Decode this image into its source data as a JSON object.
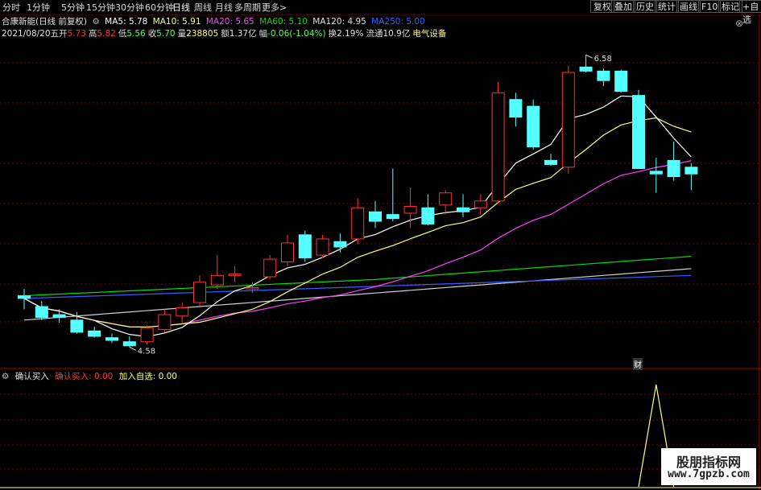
{
  "toolbar": {
    "periods": [
      "分时",
      "1分钟",
      "5分钟",
      "15分钟",
      "30分钟",
      "60分钟",
      "日线",
      "周线",
      "月线",
      "多周期",
      "更多>"
    ],
    "active_index": 6,
    "buttons": [
      "复权",
      "叠加",
      "历史",
      "统计",
      "画线",
      "F10",
      "标记",
      "+自选"
    ]
  },
  "info": {
    "name": "合康新能(日线 前复权)",
    "ma5": "MA5: 5.78",
    "ma10": "MA10: 5.91",
    "ma20": "MA20: 5.65",
    "ma60": "MA60: 5.10",
    "ma120": "MA120: 4.95",
    "ma250": "MA250: 5.00",
    "date": "2021/08/20五",
    "open_l": "开",
    "open_v": "5.73",
    "high_l": "高",
    "high_v": "5.82",
    "low_l": "低",
    "low_v": "5.56",
    "close_l": "收",
    "close_v": "5.70",
    "vol_l": "量",
    "vol_v": "238805",
    "amt_l": "额",
    "amt_v": "1.37亿",
    "chg_l": "幅",
    "chg_v": "-0.06(-1.04%)",
    "turn_l": "换",
    "turn_v": "2.19%",
    "float_l": "流通",
    "float_v": "10.9亿",
    "sector": "电气设备"
  },
  "colors": {
    "up": "#ff3232",
    "down": "#54ffff",
    "ma5": "#ffffff",
    "ma10": "#ffff80",
    "ma20": "#ff40ff",
    "ma60": "#00e000",
    "ma120": "#3060ff",
    "ma250": "#d0d0d0",
    "grid": "#7a0000"
  },
  "annotations": {
    "high": "6.58",
    "low": "4.58"
  },
  "indicator": {
    "name": "确认买入",
    "line1": "确认买入: 0.00",
    "line2": "加入自选: 0.00"
  },
  "cai_badge": "财",
  "watermark": {
    "line1": "股朋指标网",
    "line2": "www.7gpzb.com"
  },
  "chart_data": {
    "type": "candlestick",
    "ohlc": [
      [
        4.8,
        4.85,
        4.7,
        4.78
      ],
      [
        4.72,
        4.76,
        4.62,
        4.64
      ],
      [
        4.66,
        4.7,
        4.6,
        4.64
      ],
      [
        4.62,
        4.68,
        4.52,
        4.53
      ],
      [
        4.54,
        4.57,
        4.49,
        4.5
      ],
      [
        4.49,
        4.52,
        4.45,
        4.47
      ],
      [
        4.46,
        4.5,
        4.42,
        4.43
      ],
      [
        4.46,
        4.58,
        4.44,
        4.56
      ],
      [
        4.55,
        4.7,
        4.53,
        4.66
      ],
      [
        4.65,
        4.75,
        4.6,
        4.71
      ],
      [
        4.75,
        4.95,
        4.72,
        4.9
      ],
      [
        4.88,
        5.1,
        4.85,
        4.95
      ],
      [
        4.95,
        5.02,
        4.9,
        4.96
      ],
      [
        4.85,
        4.9,
        4.82,
        4.86
      ],
      [
        4.94,
        5.1,
        4.92,
        5.07
      ],
      [
        5.05,
        5.25,
        5.02,
        5.19
      ],
      [
        5.25,
        5.28,
        5.05,
        5.08
      ],
      [
        5.1,
        5.25,
        5.08,
        5.22
      ],
      [
        5.2,
        5.26,
        5.12,
        5.16
      ],
      [
        5.22,
        5.52,
        5.18,
        5.45
      ],
      [
        5.42,
        5.5,
        5.3,
        5.35
      ],
      [
        5.4,
        5.74,
        5.35,
        5.37
      ],
      [
        5.41,
        5.6,
        5.3,
        5.46
      ],
      [
        5.45,
        5.55,
        5.32,
        5.33
      ],
      [
        5.47,
        5.58,
        5.4,
        5.56
      ],
      [
        5.45,
        5.55,
        5.38,
        5.42
      ],
      [
        5.45,
        5.55,
        5.4,
        5.5
      ],
      [
        5.5,
        6.38,
        5.48,
        6.3
      ],
      [
        6.25,
        6.3,
        6.05,
        6.12
      ],
      [
        6.2,
        6.25,
        5.88,
        5.9
      ],
      [
        5.8,
        5.85,
        5.76,
        5.77
      ],
      [
        5.75,
        6.5,
        5.7,
        6.45
      ],
      [
        6.49,
        6.58,
        6.45,
        6.46
      ],
      [
        6.46,
        6.48,
        6.35,
        6.39
      ],
      [
        6.46,
        6.47,
        6.3,
        6.31
      ],
      [
        6.28,
        6.32,
        5.74,
        5.74
      ],
      [
        5.72,
        5.82,
        5.56,
        5.7
      ],
      [
        5.8,
        5.94,
        5.65,
        5.68
      ],
      [
        5.75,
        5.78,
        5.58,
        5.7
      ]
    ],
    "indicator_values": [
      0,
      0,
      0,
      0,
      0,
      0,
      0,
      0,
      0,
      0,
      0,
      0,
      0,
      0,
      0,
      0,
      0,
      0,
      0,
      0,
      0,
      0,
      0,
      0,
      0,
      0,
      0,
      0,
      0,
      0,
      0,
      0,
      0,
      0,
      0,
      0,
      1,
      0,
      0
    ]
  }
}
